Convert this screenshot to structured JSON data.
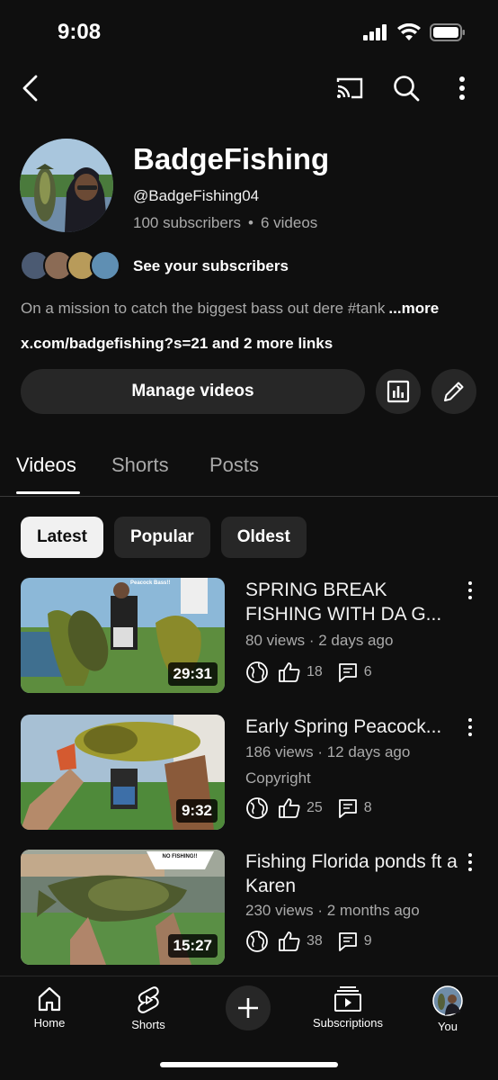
{
  "status": {
    "time": "9:08"
  },
  "channel": {
    "name": "BadgeFishing",
    "handle": "@BadgeFishing04",
    "subscribers": "100 subscribers",
    "separator": "•",
    "videos": "6 videos",
    "see_subscribers": "See your subscribers",
    "bio": "On a mission to catch the biggest bass out dere #tank",
    "bio_more": "...more",
    "links": "x.com/badgefishing?s=21 and 2 more links"
  },
  "actions": {
    "manage": "Manage videos"
  },
  "tabs": [
    {
      "label": "Videos"
    },
    {
      "label": "Shorts"
    },
    {
      "label": "Posts"
    }
  ],
  "chips": [
    {
      "label": "Latest"
    },
    {
      "label": "Popular"
    },
    {
      "label": "Oldest"
    }
  ],
  "videos": [
    {
      "title": "SPRING BREAK FISHING WITH DA G...",
      "meta": "80 views · 2 days ago",
      "extra": "",
      "duration": "29:31",
      "likes": "18",
      "comments": "6",
      "thumb_label": "Peacock Bass!!"
    },
    {
      "title": "Early Spring Peacock...",
      "meta": "186 views · 12 days ago",
      "extra": "Copyright",
      "duration": "9:32",
      "likes": "25",
      "comments": "8",
      "thumb_label": ""
    },
    {
      "title": "Fishing Florida ponds ft a Karen",
      "meta": "230 views · 2 months ago",
      "extra": "",
      "duration": "15:27",
      "likes": "38",
      "comments": "9",
      "thumb_label": "NO FISHING!!"
    }
  ],
  "nav": {
    "home": "Home",
    "shorts": "Shorts",
    "subscriptions": "Subscriptions",
    "you": "You"
  },
  "icons": [
    "back-icon",
    "cast-icon",
    "search-icon",
    "more-vert-icon",
    "analytics-icon",
    "edit-pencil-icon",
    "globe-icon",
    "thumb-up-icon",
    "comment-icon",
    "home-icon",
    "shorts-icon",
    "plus-icon",
    "subscriptions-icon"
  ]
}
